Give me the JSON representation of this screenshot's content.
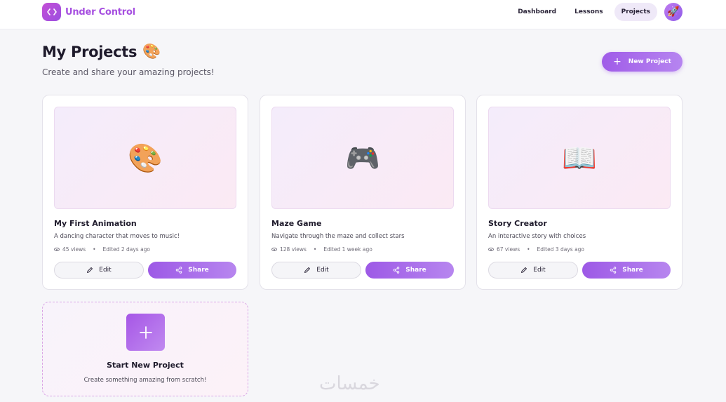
{
  "app": {
    "name": "Under Control"
  },
  "nav": {
    "links": [
      {
        "label": "Dashboard"
      },
      {
        "label": "Lessons"
      },
      {
        "label": "Projects"
      }
    ],
    "avatar_emoji": "🚀"
  },
  "page": {
    "title": "My Projects",
    "title_emoji": "🎨",
    "subtitle": "Create and share your amazing projects!",
    "new_button": "New Project"
  },
  "projects": [
    {
      "emoji": "🎨",
      "title": "My First Animation",
      "desc": "A dancing character that moves to music!",
      "views": "45 views",
      "edited": "Edited 2 days ago",
      "edit": "Edit",
      "share": "Share"
    },
    {
      "emoji": "🎮",
      "title": "Maze Game",
      "desc": "Navigate through the maze and collect stars",
      "views": "128 views",
      "edited": "Edited 1 week ago",
      "edit": "Edit",
      "share": "Share"
    },
    {
      "emoji": "📖",
      "title": "Story Creator",
      "desc": "An interactive story with choices",
      "views": "67 views",
      "edited": "Edited 3 days ago",
      "edit": "Edit",
      "share": "Share"
    }
  ],
  "start_card": {
    "title": "Start New Project",
    "desc": "Create something amazing from scratch!"
  },
  "watermark": "خمسات",
  "colors": {
    "accent": "#a05ce8",
    "brand": "#a64fe0"
  }
}
